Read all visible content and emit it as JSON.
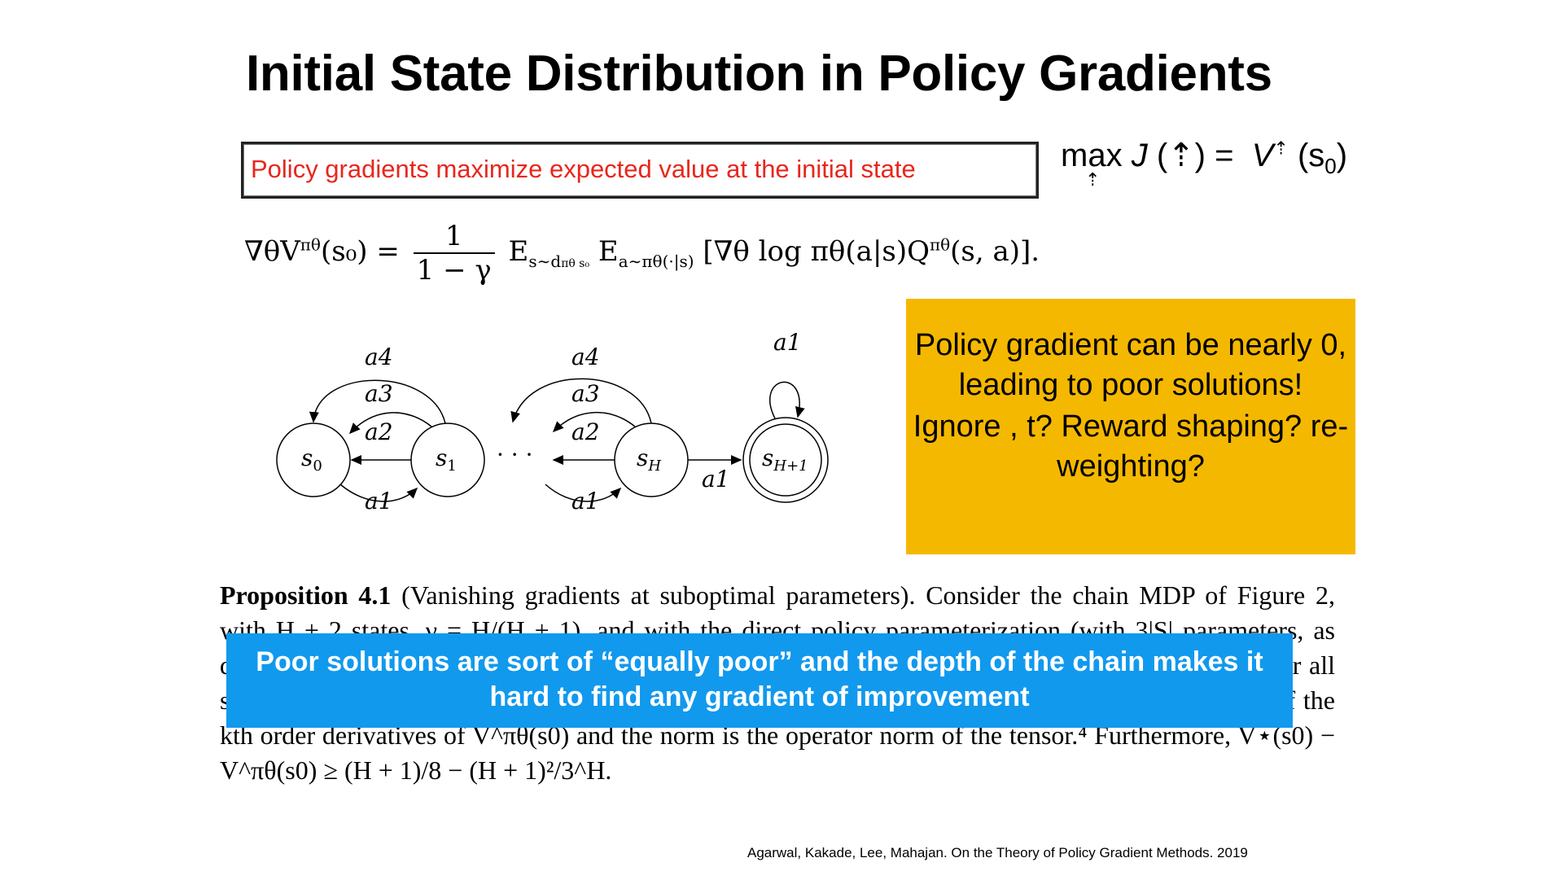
{
  "title": "Initial State Distribution in Policy Gradients",
  "red_box_text": "Policy gradients maximize expected value at the initial state",
  "objective": {
    "max": "max",
    "J": "J",
    "theta_glyph": "⇡",
    "equals": "=",
    "V": "V",
    "s0": "(s",
    "zero": "0",
    "close": ")"
  },
  "gradient_formula": {
    "lhs": "∇θV",
    "lhs_sup": "πθ",
    "lhs_arg": "(s₀) =",
    "frac_num": "1",
    "frac_den": "1 − γ",
    "e1": "E",
    "e1_sub": "s∼d",
    "e1_sub2": "πθ s₀",
    "e2": "E",
    "e2_sub": "a∼πθ(·|s)",
    "body": "[∇θ log πθ(a|s)Q",
    "body_sup": "πθ",
    "body_end": "(s, a)]."
  },
  "diagram": {
    "nodes": [
      "s",
      "s",
      "s",
      "s"
    ],
    "node_subs": [
      "0",
      "1",
      "H",
      "H+1"
    ],
    "left_labels": [
      "a4",
      "a3",
      "a2",
      "a1"
    ],
    "mid_labels": [
      "a4",
      "a3",
      "a2",
      "a1"
    ],
    "self_loop": "a1",
    "arrow_right": "a1",
    "ellipsis": "· · ·"
  },
  "yellow_box": {
    "line1": "Policy gradient can be nearly 0, leading to poor solutions!",
    "line2": "Ignore , t? Reward shaping? re-weighting?"
  },
  "proposition": {
    "heading": "Proposition 4.1",
    "paren": "(Vanishing gradients at suboptimal parameters).",
    "text1": "Consider the chain MDP of Figure 2, with H + 2 states, γ = H/(H + 1), and with the direct policy parameterization (with 3|S| parameters, as described in the text above). Suppose θ is such that 0 < θ < 1 (componentwise) and θ[s, a1] < 1/4 (for all states s). For all k ≤ H/40 − 1, we have ‖∇θᵏV^πθ(s0)‖ ≤ (1/3)^H/4,",
    "text2": "where ∇θᵏV^πθ(s0) is a tensor of the kth order derivatives of V^πθ(s0) and the norm is the operator norm of the tensor.⁴ Furthermore, V⋆(s0) − V^πθ(s0) ≥ (H + 1)/8 − (H + 1)²/3^H."
  },
  "blue_bar": "Poor solutions are sort of “equally poor” and the depth of the chain makes it hard to find any gradient of improvement",
  "citation": "Agarwal, Kakade, Lee, Mahajan. On the Theory of Policy Gradient Methods. 2019",
  "colors": {
    "red_text": "#e8261d",
    "yellow_bg": "#f5b800",
    "blue_bg": "#1199ee"
  }
}
